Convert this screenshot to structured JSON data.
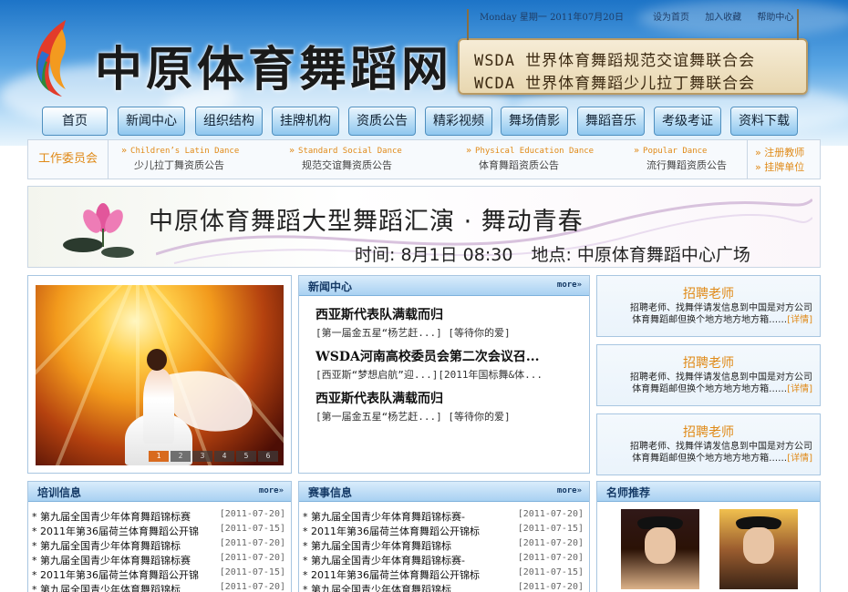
{
  "header": {
    "site_title": "中原体育舞蹈网",
    "date_text": "Monday 星期一 2011年07月20日",
    "top_links": [
      "设为首页",
      "加入收藏",
      "帮助中心"
    ],
    "board_lines": [
      "WSDA 世界体育舞蹈规范交谊舞联合会",
      "WCDA 世界体育舞蹈少儿拉丁舞联合会"
    ]
  },
  "nav": {
    "items": [
      "首页",
      "新闻中心",
      "组织结构",
      "挂牌机构",
      "资质公告",
      "精彩视频",
      "舞场倩影",
      "舞蹈音乐",
      "考级考证",
      "资料下载"
    ]
  },
  "committee": {
    "label": "工作委员会",
    "items": [
      {
        "en": "Children’s Latin Dance",
        "cn": "少儿拉丁舞资质公告"
      },
      {
        "en": "Standard Social Dance",
        "cn": "规范交谊舞资质公告"
      },
      {
        "en": "Physical Education Dance",
        "cn": "体育舞蹈资质公告"
      },
      {
        "en": "Popular Dance",
        "cn": "流行舞蹈资质公告"
      }
    ],
    "links": [
      "注册教师",
      "挂牌单位"
    ]
  },
  "banner": {
    "title": "中原体育舞蹈大型舞蹈汇演 · 舞动青春",
    "time": "时间: 8月1日 08:30",
    "place": "地点: 中原体育舞蹈中心广场"
  },
  "slideshow": {
    "pages": [
      "1",
      "2",
      "3",
      "4",
      "5",
      "6"
    ]
  },
  "news": {
    "title": "新闻中心",
    "more": "more»",
    "lines": [
      {
        "type": "h",
        "text": "西亚斯代表队满载而归"
      },
      {
        "type": "s",
        "text": "[第一届金五星“杨艺赶...] [等待你的爱]"
      },
      {
        "type": "h",
        "text": "WSDA河南高校委员会第二次会议召..."
      },
      {
        "type": "s",
        "text": "[西亚斯“梦想启航”迎...][2011年国标舞&体..."
      },
      {
        "type": "h",
        "text": "西亚斯代表队满载而归"
      },
      {
        "type": "s",
        "text": "[第一届金五星“杨艺赶...] [等待你的爱]"
      }
    ]
  },
  "recruit": {
    "title": "招聘老师",
    "body_line1": "招聘老师、找舞伴请发信息到中国是对方公司",
    "body_line2": "体育舞蹈邮但换个地方地方地方箱……",
    "detail": "[详情]"
  },
  "training": {
    "title": "培训信息",
    "more": "more»",
    "rows": [
      {
        "t": "* 第九届全国青少年体育舞蹈锦标赛",
        "d": "[2011-07-20]"
      },
      {
        "t": "* 2011年第36届荷兰体育舞蹈公开锦",
        "d": "[2011-07-15]"
      },
      {
        "t": "* 第九届全国青少年体育舞蹈锦标",
        "d": "[2011-07-20]"
      },
      {
        "t": "* 第九届全国青少年体育舞蹈锦标赛",
        "d": "[2011-07-20]"
      },
      {
        "t": "* 2011年第36届荷兰体育舞蹈公开锦",
        "d": "[2011-07-15]"
      },
      {
        "t": "* 第九届全国青少年体育舞蹈锦标",
        "d": "[2011-07-20]"
      }
    ]
  },
  "events": {
    "title": "赛事信息",
    "more": "more»",
    "rows": [
      {
        "t": "* 第九届全国青少年体育舞蹈锦标赛-",
        "d": "[2011-07-20]"
      },
      {
        "t": "* 2011年第36届荷兰体育舞蹈公开锦标",
        "d": "[2011-07-15]"
      },
      {
        "t": "* 第九届全国青少年体育舞蹈锦标",
        "d": "[2011-07-20]"
      },
      {
        "t": "* 第九届全国青少年体育舞蹈锦标赛-",
        "d": "[2011-07-20]"
      },
      {
        "t": "* 2011年第36届荷兰体育舞蹈公开锦标",
        "d": "[2011-07-15]"
      },
      {
        "t": "* 第九届全国青少年体育舞蹈锦标",
        "d": "[2011-07-20]"
      }
    ]
  },
  "teachers": {
    "title": "名师推荐"
  }
}
